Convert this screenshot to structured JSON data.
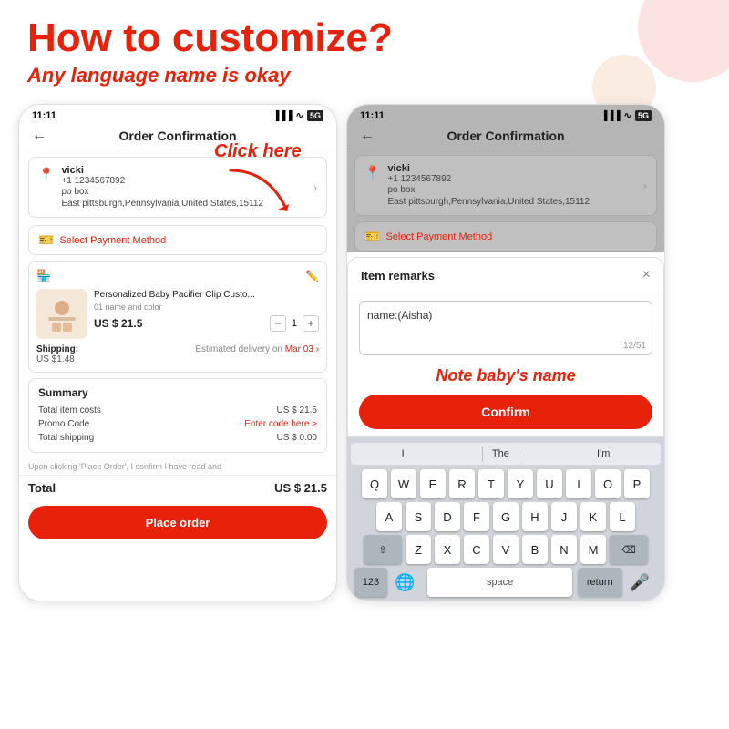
{
  "page": {
    "title": "How to customize?",
    "subtitle": "Any language name is okay"
  },
  "left_phone": {
    "status_bar": {
      "time": "11:11",
      "signal": "signal",
      "wifi": "wifi",
      "battery": "5G"
    },
    "nav": {
      "back": "←",
      "title": "Order Confirmation"
    },
    "address": {
      "name": "vicki",
      "phone": "+1 1234567892",
      "pobox": "po box",
      "location": "East pittsburgh,Pennsylvania,United States,15112"
    },
    "payment": {
      "label": "Select Payment Method"
    },
    "product": {
      "name": "Personalized Baby Pacifier Clip Custo...",
      "variant": "01 name and color",
      "price": "US $ 21.5",
      "qty": "1",
      "shipping_cost": "US $1.48",
      "delivery": "Estimated delivery on Mar 03"
    },
    "summary": {
      "title": "Summary",
      "item_costs_label": "Total item costs",
      "item_costs_value": "US $ 21.5",
      "promo_label": "Promo Code",
      "promo_value": "Enter code here >",
      "shipping_label": "Total shipping",
      "shipping_value": "US $ 0.00",
      "disclaimer": "Upon clicking 'Place Order', I confirm I have read and",
      "total_label": "Total",
      "total_value": "US $ 21.5"
    },
    "place_order": "Place order"
  },
  "right_phone": {
    "status_bar": {
      "time": "11:11",
      "signal": "signal",
      "wifi": "wifi",
      "battery": "5G"
    },
    "nav": {
      "back": "←",
      "title": "Order Confirmation"
    },
    "address": {
      "name": "vicki",
      "phone": "+1 1234567892",
      "pobox": "po box",
      "location": "East pittsburgh,Pennsylvania,United States,15112"
    },
    "payment_label": "Select Payment Method",
    "modal": {
      "title": "Item remarks",
      "close": "×",
      "input_text": "name:(Aisha)",
      "counter": "12/51",
      "note_label": "Note baby's name",
      "confirm_btn": "Confirm"
    },
    "keyboard": {
      "suggestions": [
        "I",
        "The",
        "I'm"
      ],
      "row1": [
        "Q",
        "W",
        "E",
        "R",
        "T",
        "Y",
        "U",
        "I",
        "O",
        "P"
      ],
      "row2": [
        "A",
        "S",
        "D",
        "F",
        "G",
        "H",
        "J",
        "K",
        "L"
      ],
      "row3": [
        "Z",
        "X",
        "C",
        "V",
        "B",
        "N",
        "M"
      ],
      "space_label": "space",
      "return_label": "return",
      "num_label": "123"
    }
  },
  "annotation": {
    "click_here": "Click here"
  }
}
